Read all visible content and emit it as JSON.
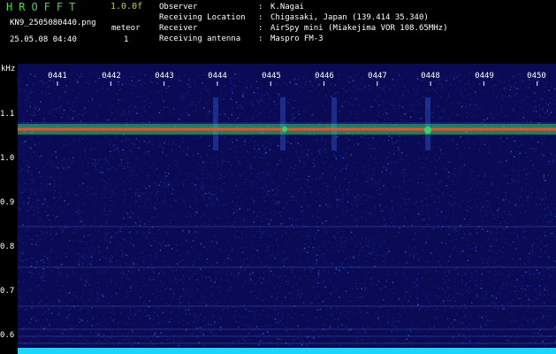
{
  "header": {
    "app_title": "HROFFT",
    "version": "1.0.0f",
    "filename": "KN9_2505080440.png",
    "datetime": "25.05.08 04:40",
    "meteor_label": "meteor",
    "meteor_count": "1",
    "info": [
      {
        "key": "Observer",
        "value": "K.Nagai"
      },
      {
        "key": "Receiving Location",
        "value": "Chigasaki, Japan (139.414 35.340)"
      },
      {
        "key": "Receiver",
        "value": "AirSpy mini (Miakejima VOR 108.65MHz)"
      },
      {
        "key": "Receiving antenna",
        "value": "Maspro FM-3"
      }
    ]
  },
  "spectrogram": {
    "y_unit": "kHz",
    "y_labels": [
      "1.1",
      "1.0",
      "0.9",
      "0.8",
      "0.7",
      "0.6"
    ],
    "time_labels": [
      "0441",
      "0442",
      "0443",
      "0444",
      "0445",
      "0446",
      "0447",
      "0448",
      "0449",
      "0450"
    ],
    "colors": {
      "background": "#0a0a55",
      "noise_low": "#1d2a9c",
      "noise_high": "#3a6ee8",
      "carrier_core": "#ff4a2a",
      "carrier_glow": "#2fd86a",
      "baseline": "#19d6ff"
    }
  }
}
